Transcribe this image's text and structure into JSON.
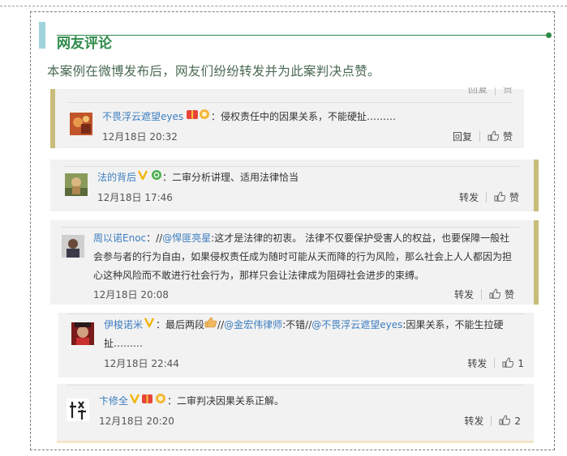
{
  "section": {
    "title": "网友评论",
    "subtitle": "本案例在微博发布后，网友们纷纷转发并为此案判决点赞。"
  },
  "colors": {
    "accent_green": "#2e8a4a",
    "link_blue": "#3d7ec0",
    "card_bg": "#f2f2f2",
    "stripe": "#c8bd7a"
  },
  "comments": [
    {
      "user": "不畏浮云遮望eyes",
      "text": "：侵权责任中的因果关系，不能硬扯………",
      "time": "12月18日 20:32",
      "action": "回复",
      "like": "赞"
    },
    {
      "user": "法的背后",
      "text": "：二审分析讲理、适用法律恰当",
      "time": "12月18日 17:46",
      "action": "转发",
      "like": "赞"
    },
    {
      "user": "周以诺Enoc",
      "prefix": "：//",
      "mention": "@悍匪亮星",
      "text_line1": ":这才是法律的初衷。 法律不仅要保护受害人的权益，也要保障一般社",
      "text_line2": "会参与者的行为自由，如果侵权责任成为随时可能从天而降的行为风险，那么社会上人人都因为担",
      "text_line3": "心这种风险而不敢进行社会行为，那样只会让法律成为阻碍社会进步的束缚。",
      "time": "12月18日 20:08",
      "action": "转发",
      "like": "赞"
    },
    {
      "user": "伊梭诺米",
      "part1": "：最后两段",
      "part2": "//",
      "mention1": "@金宏伟律师",
      "part3": ":不错//",
      "mention2": "@不畏浮云遮望eyes",
      "part4": ":因果关系，不能生拉硬",
      "line2": "扯………",
      "time": "12月18日 22:44",
      "action": "转发",
      "like_count": "1"
    },
    {
      "user": "卞修全",
      "text": "：二审判决因果关系正解。",
      "time": "12月18日 20:20",
      "action": "转发",
      "like_count": "2"
    }
  ],
  "partial_top": {
    "action": "回复",
    "like": "赞"
  }
}
